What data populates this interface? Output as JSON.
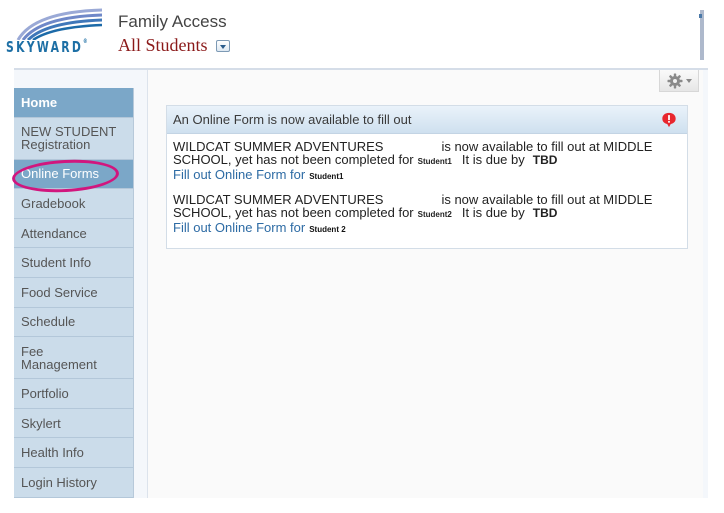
{
  "header": {
    "logo_text": "SKYWARD",
    "logo_mark": "®",
    "app_title": "Family Access",
    "student_selector": "All Students"
  },
  "sidebar": {
    "items": [
      {
        "label": "Home",
        "state": "active"
      },
      {
        "label": "NEW STUDENT",
        "label2": "Registration"
      },
      {
        "label": "Online Forms",
        "state": "selected"
      },
      {
        "label": "Gradebook"
      },
      {
        "label": "Attendance"
      },
      {
        "label": "Student Info"
      },
      {
        "label": "Food Service"
      },
      {
        "label": "Schedule"
      },
      {
        "label": "Fee",
        "label2": "Management"
      },
      {
        "label": "Portfolio"
      },
      {
        "label": "Skylert"
      },
      {
        "label": "Health Info"
      },
      {
        "label": "Login History"
      }
    ]
  },
  "toolbar": {
    "gear_icon": "gear-icon"
  },
  "panel": {
    "title": "An Online Form is now available to fill out",
    "alert_icon": "alert-bubble-icon",
    "alert_color": "#e8262e",
    "entries": [
      {
        "form_name": "WILDCAT SUMMER ADVENTURES",
        "text_available": "is now available to fill out at MIDDLE",
        "text_school": "SCHOOL, yet has not been completed for",
        "student": "Student1",
        "text_due": "It is due by",
        "due": "TBD",
        "link": "Fill out Online Form for",
        "link_student": "Student1"
      },
      {
        "form_name": "WILDCAT SUMMER ADVENTURES",
        "text_available": "is now available to fill out at MIDDLE",
        "text_school": "SCHOOL, yet has not been completed for",
        "student": "Student2",
        "text_due": "It is due by",
        "due": "TBD",
        "link": "Fill out Online Form for",
        "link_student": "Student 2"
      }
    ]
  },
  "colors": {
    "sidebar_bg": "#cbdcea",
    "sidebar_active": "#7ba7c8",
    "link": "#2d6ba4",
    "annotation_circle": "#d1167e",
    "student_selector": "#8b1a1a"
  }
}
